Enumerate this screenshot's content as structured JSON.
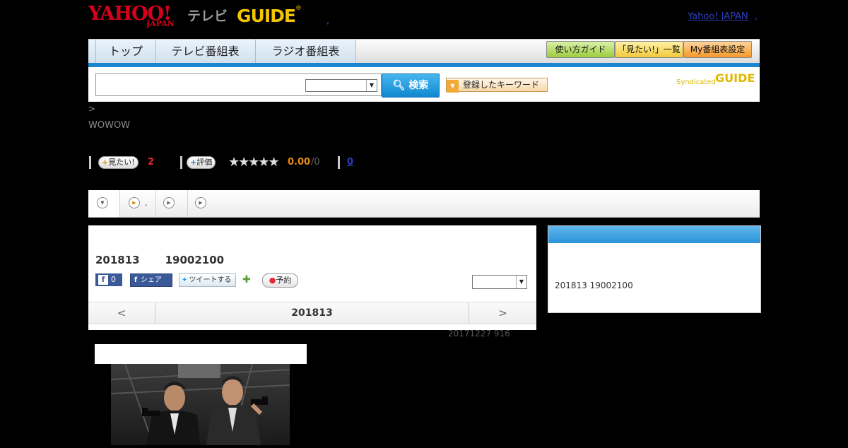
{
  "header": {
    "yahoo_line1": "YAHOO!",
    "yahoo_line2": "JAPAN",
    "tv_label": "テレビ",
    "gguide_label": "GUIDE",
    "gguide_reg": "®",
    "dot": ",",
    "yahoo_japan_link": "Yahoo! JAPAN",
    "link_sep": ","
  },
  "nav": {
    "tabs": [
      "トップ",
      "テレビ番組表",
      "ラジオ番組表"
    ],
    "buttons": [
      "使い方ガイド",
      "「見たい!」一覧",
      "My番組表設定"
    ]
  },
  "search": {
    "button_label": "検索",
    "keyword_button": "登録したキーワード",
    "syndicated": "Syndicated",
    "syndicated_logo": "GUIDE"
  },
  "breadcrumb": ">",
  "channel": "WOWOW",
  "stats": {
    "want_label": "見たい!",
    "want_count": "2",
    "rate_label": "評価",
    "stars": "★★★★★",
    "score": "0.00",
    "score_total": "/0",
    "count": "0"
  },
  "subtabs": [
    {
      "label": ""
    },
    {
      "label": ","
    },
    {
      "label": ""
    },
    {
      "label": ""
    }
  ],
  "program": {
    "title_date": "201813",
    "title_time": "19002100",
    "fb_count": "0",
    "share_label": "シェア",
    "tweet_label": "ツイートする",
    "reserve_label": "予約",
    "date_nav": {
      "prev": "<",
      "current": "201813",
      "next": ">"
    }
  },
  "updated": "20171227  916",
  "side": {
    "text": "201813  19002100"
  },
  "colors": {
    "accent_blue": "#1b86d2",
    "yahoo_red": "#d6001c",
    "gguide_yellow": "#f2c500",
    "score_orange": "#e88a1a"
  }
}
